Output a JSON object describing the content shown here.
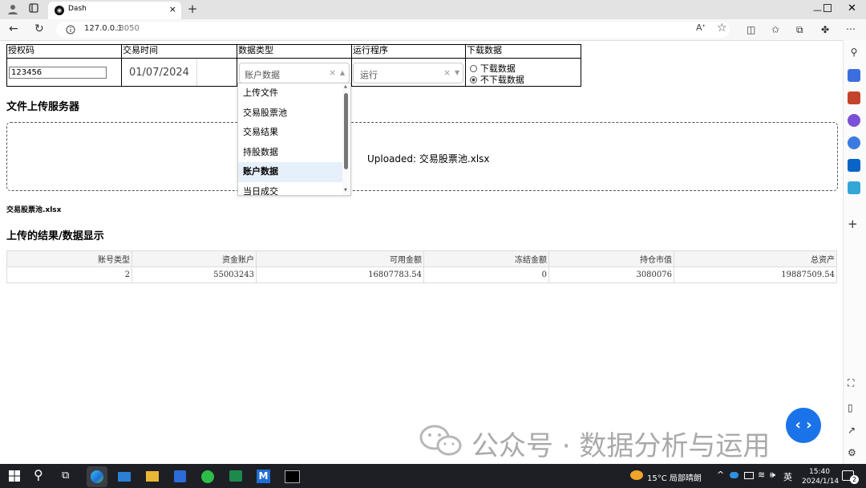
{
  "browser": {
    "tab_title": "Dash",
    "url_host": "127.0.0.1",
    "url_port": ":8050",
    "tab_close": "×",
    "new_tab": "+"
  },
  "controls": {
    "headers": [
      "授权码",
      "交易时间",
      "数据类型",
      "运行程序",
      "下载数据"
    ],
    "auth_value": "123456",
    "date_value": "01/07/2024",
    "data_type_selected": "账户数据",
    "program_selected": "运行",
    "clear_symbol": "×",
    "download_options": [
      "下载数据",
      "不下载数据"
    ],
    "download_selected_index": 1
  },
  "dropdown_menu": {
    "items": [
      "上传文件",
      "交易股票池",
      "交易结果",
      "持股数据",
      "账户数据",
      "当日成交"
    ],
    "selected_index": 4
  },
  "upload": {
    "heading": "文件上传服务器",
    "status": "Uploaded: 交易股票池.xlsx",
    "filename": "交易股票池.xlsx"
  },
  "results": {
    "heading": "上传的结果/数据显示",
    "columns": [
      "账号类型",
      "资金账户",
      "可用金额",
      "冻结金额",
      "持仓市值",
      "总资产"
    ],
    "rows": [
      [
        "2",
        "55003243",
        "16807783.54",
        "0",
        "3080076",
        "19887509.54"
      ]
    ]
  },
  "watermark": "公众号 · 数据分析与运用",
  "taskbar": {
    "weather": "15°C 局部晴朗",
    "ime": "英",
    "time": "15:40",
    "date": "2024/1/14",
    "notif_count": "2"
  },
  "colors": {
    "selected_menu": "#e6f0fb",
    "fab": "#1a73e8",
    "taskbar": "#1d1f24"
  }
}
